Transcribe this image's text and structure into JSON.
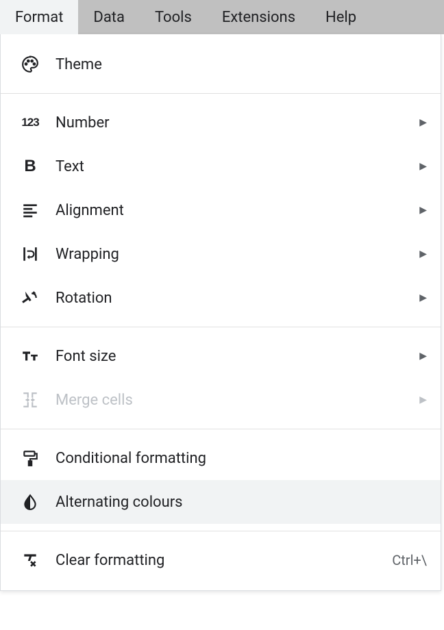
{
  "menubar": {
    "items": [
      {
        "label": "Format"
      },
      {
        "label": "Data"
      },
      {
        "label": "Tools"
      },
      {
        "label": "Extensions"
      },
      {
        "label": "Help"
      }
    ]
  },
  "dropdown": {
    "theme": {
      "label": "Theme"
    },
    "number": {
      "label": "Number"
    },
    "text": {
      "label": "Text"
    },
    "alignment": {
      "label": "Alignment"
    },
    "wrapping": {
      "label": "Wrapping"
    },
    "rotation": {
      "label": "Rotation"
    },
    "fontsize": {
      "label": "Font size"
    },
    "mergecells": {
      "label": "Merge cells"
    },
    "conditional": {
      "label": "Conditional formatting"
    },
    "alternating": {
      "label": "Alternating colours"
    },
    "clear": {
      "label": "Clear formatting",
      "shortcut": "Ctrl+\\"
    }
  }
}
